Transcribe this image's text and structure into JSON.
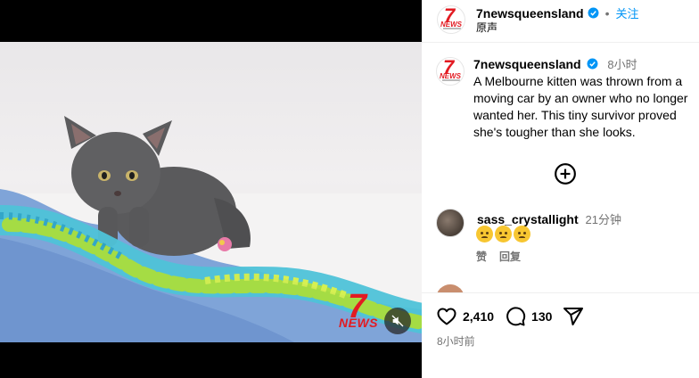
{
  "header": {
    "username": "7newsqueensland",
    "follow_label": "关注",
    "audio_label": "原声"
  },
  "caption": {
    "username": "7newsqueensland",
    "time": "8小时",
    "text": "A Melbourne kitten was thrown from a moving car by an owner who no longer wanted her. This tiny survivor proved she's tougher than she looks."
  },
  "comments": [
    {
      "username": "sass_crystallight",
      "time": "21分钟",
      "emoji_count": 3,
      "like_label": "赞",
      "reply_label": "回复"
    }
  ],
  "footer": {
    "likes": "2,410",
    "comments": "130",
    "posted": "8小时前"
  },
  "colors": {
    "brand_red": "#e21b22",
    "verified_blue": "#0095f6",
    "muted_text": "#737373"
  },
  "icons": [
    "verified-badge-icon",
    "plus-circle-icon",
    "heart-icon",
    "comment-icon",
    "share-icon",
    "mute-icon"
  ]
}
